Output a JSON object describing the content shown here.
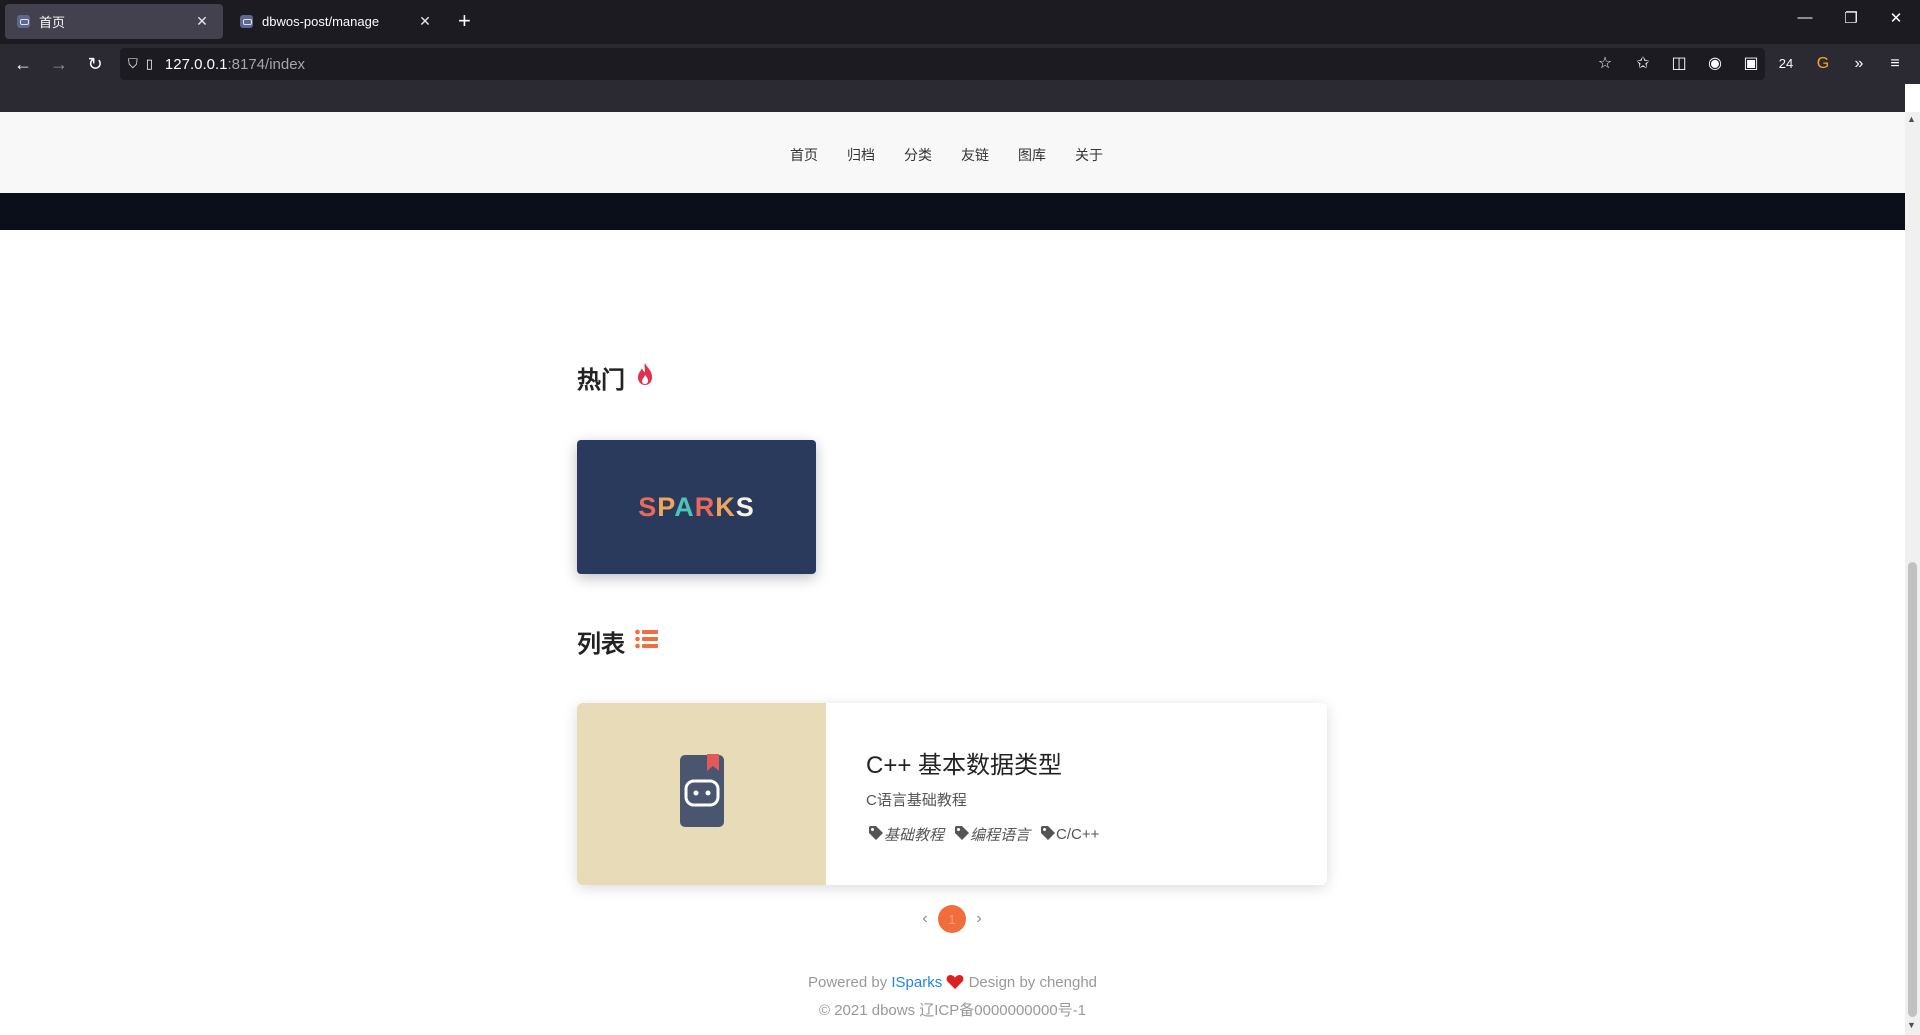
{
  "browser": {
    "tabs": [
      {
        "title": "首页",
        "active": true
      },
      {
        "title": "dbwos-post/manage",
        "active": false
      }
    ],
    "new_tab_label": "+",
    "url_host": "127.0.0.1",
    "url_rest": ":8174/index",
    "badge_count": "24"
  },
  "site": {
    "nav": [
      "首页",
      "归档",
      "分类",
      "友链",
      "图库",
      "关于"
    ],
    "hot_title": "热门",
    "hot_card_logo": "SPARKS",
    "list_title": "列表",
    "posts": [
      {
        "title": "C++ 基本数据类型",
        "subtitle": "C语言基础教程",
        "tags": [
          "基础教程",
          "编程语言",
          "C/C++"
        ]
      }
    ],
    "pager": {
      "current": "1",
      "prev": "‹",
      "next": "›"
    }
  },
  "footer": {
    "powered_prefix": "Powered by",
    "powered_link": "ISparks",
    "design_text": "Design by chenghd",
    "copyright": "© 2021 dbows 辽ICP备0000000000号-1"
  },
  "colors": {
    "accent_orange": "#f26d3c",
    "fire_red": "#e0314f",
    "link_blue": "#1e88e5",
    "hot_card_bg": "#2a3a5c",
    "post_thumb_bg": "#e8dcb8"
  }
}
